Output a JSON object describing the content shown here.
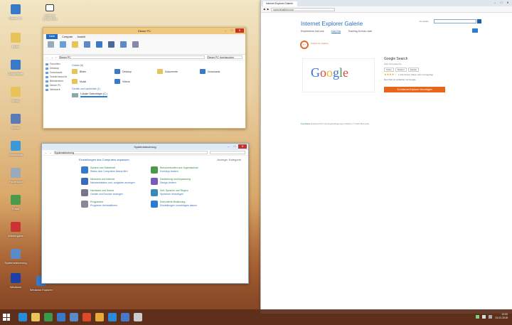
{
  "desktop": {
    "icons": [
      {
        "label": "Dieser PC",
        "color": "#3a78c8"
      },
      {
        "label": "Bilder",
        "color": "#e8c35a"
      },
      {
        "label": "Dokumente",
        "color": "#3a78c8"
      },
      {
        "label": "Musik",
        "color": "#e8c35a"
      },
      {
        "label": "Videos",
        "color": "#5a7ab8"
      },
      {
        "label": "Downloads",
        "color": "#3a9ad8"
      },
      {
        "label": "Papierkorb",
        "color": "#9ab"
      },
      {
        "label": "Fotos",
        "color": "#4a9a4a"
      },
      {
        "label": "Wiedergabe",
        "color": "#c33"
      },
      {
        "label": "Systemsteuerung",
        "color": "#5a8ac8"
      },
      {
        "label": "Windows",
        "color": "#1d3fa8"
      },
      {
        "label": "Windows Explorer",
        "color": "#3a78c8"
      }
    ],
    "top_file": {
      "label1": "Datei.txt",
      "label2": "01.01.2015"
    }
  },
  "explorer": {
    "title": "Dieser PC",
    "ribbon_tabs": [
      "Datei",
      "Computer",
      "Ansicht"
    ],
    "address": "Dieser PC",
    "search_placeholder": "Dieser PC durchsuchen",
    "nav_items": [
      "Favoriten",
      "Desktop",
      "Downloads",
      "Zuletzt besucht",
      "Bibliotheken",
      "Dieser PC",
      "Netzwerk"
    ],
    "section_folders": "Ordner (6)",
    "folders": [
      "Bilder",
      "Desktop",
      "Dokumente",
      "Downloads",
      "Musik",
      "Videos"
    ],
    "section_drives": "Geräte und Laufwerke (1)",
    "drive": "Lokaler Datenträger (C:)"
  },
  "control_panel": {
    "title": "Systemsteuerung",
    "heading": "Einstellungen des Computers anpassen",
    "view_label": "Anzeige: Kategorie",
    "items": [
      {
        "title": "System und Sicherheit",
        "desc": "Status des Computers überprüfen",
        "color": "#3a78c8"
      },
      {
        "title": "Benutzerkonten und Jugendschutz",
        "desc": "Kontotyp ändern",
        "color": "#4a9a4a"
      },
      {
        "title": "Netzwerk und Internet",
        "desc": "Netzwerkstatus und -aufgaben anzeigen",
        "color": "#3a6ab8"
      },
      {
        "title": "Darstellung und Anpassung",
        "desc": "Design ändern",
        "color": "#7a5ab8"
      },
      {
        "title": "Hardware und Sound",
        "desc": "Geräte und Drucker anzeigen",
        "color": "#778"
      },
      {
        "title": "Zeit, Sprache und Region",
        "desc": "Sprachen hinzufügen",
        "color": "#3a8ab8"
      },
      {
        "title": "Programme",
        "desc": "Programm deinstallieren",
        "color": "#889"
      },
      {
        "title": "Erleichterte Bedienung",
        "desc": "Einstellungen vorschlagen lassen",
        "color": "#2a7ad8"
      }
    ]
  },
  "browser": {
    "tab_label": "Internet Explorer Galerie",
    "url": "www.iegallery.com",
    "gallery_title": "Internet Explorer Galerie",
    "nav": [
      "Empfohlene Add-ons",
      "Add-Ons",
      "Tracking-Schutz-Liste"
    ],
    "signin": "Anmelden",
    "back_label": "Zurück zur Galerie",
    "logo_text": "Google",
    "product_name": "Google Search",
    "product_sub": "Web-Schnellsuche",
    "product_buttons": [
      "Teilen",
      "Melden",
      "Details"
    ],
    "stars": "★★★★☆",
    "rating_text": "1.234 Nutzer haben dies hinzugefügt",
    "product_desc": "Das Web ist einfacher mit Google.",
    "add_button": "Zu Internet Explorer hinzufügen",
    "footer_link": "Feedback",
    "footer_text": "Datenschutz  Nutzungsbedingungen  Marken  © 2015 Microsoft"
  },
  "taskbar": {
    "apps": [
      {
        "name": "ie",
        "color": "#2a8ad8"
      },
      {
        "name": "explorer",
        "color": "#e8c35a"
      },
      {
        "name": "store",
        "color": "#3a9a4a"
      },
      {
        "name": "media",
        "color": "#3a78c8"
      },
      {
        "name": "control",
        "color": "#5a8ac8"
      },
      {
        "name": "paint",
        "color": "#d84a2a"
      },
      {
        "name": "folder",
        "color": "#e8a83a"
      },
      {
        "name": "skype",
        "color": "#2a8ad8"
      },
      {
        "name": "photo",
        "color": "#4a78c8"
      },
      {
        "name": "notes",
        "color": "#ccc"
      }
    ],
    "time": "12:00",
    "date": "01.01.2015"
  }
}
